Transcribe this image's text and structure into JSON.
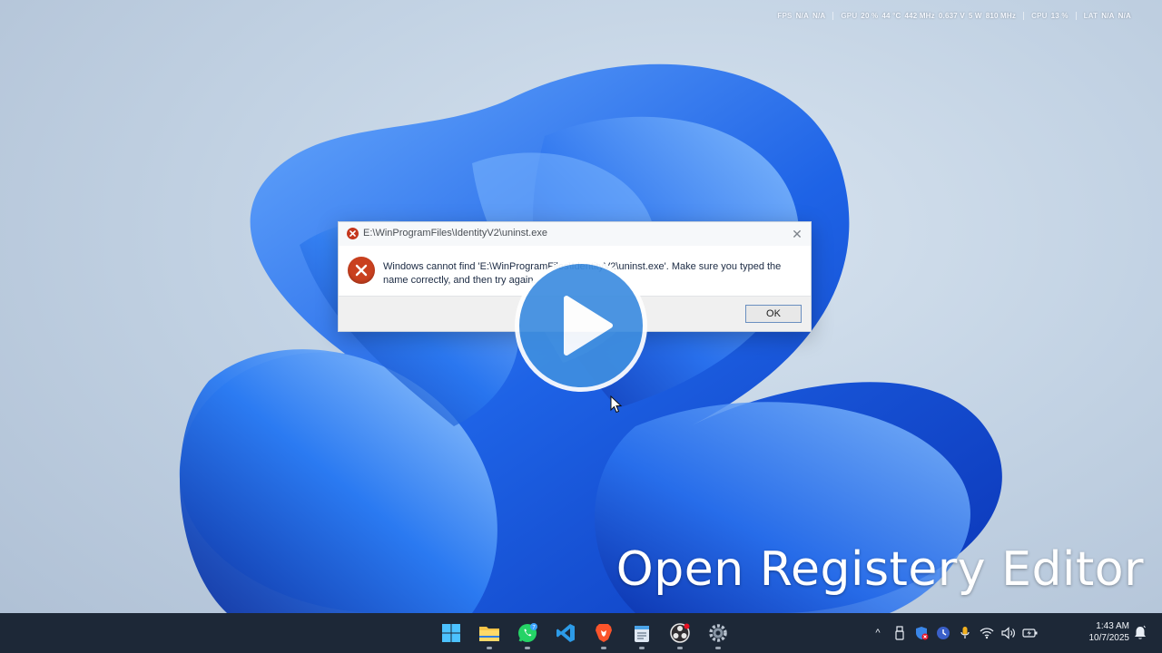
{
  "overlay": {
    "fps_label": "FPS",
    "fps_value_1": "N/A",
    "fps_value_2": "N/A",
    "gpu_label": "GPU",
    "gpu_usage": "20 %",
    "gpu_temp": "44 °C",
    "gpu_clock": "442 MHz",
    "gpu_voltage": "0.637 V",
    "gpu_power": "5 W",
    "gpu_mem": "810 MHz",
    "cpu_label": "CPU",
    "cpu_usage": "13 %",
    "lat_label": "LAT",
    "lat_value_1": "N/A",
    "lat_value_2": "N/A"
  },
  "dialog": {
    "title": "E:\\WinProgramFiles\\IdentityV2\\uninst.exe",
    "message": "Windows cannot find 'E:\\WinProgramFiles\\IdentityV2\\uninst.exe'. Make sure you typed the name correctly, and then try again.",
    "ok_label": "OK",
    "close_glyph": "✕"
  },
  "caption": "Open Registery Editor",
  "taskbar": {
    "apps": [
      "windows-start-icon",
      "file-explorer-icon",
      "whatsapp-icon",
      "vscode-icon",
      "brave-icon",
      "notepad-icon",
      "obs-icon",
      "settings-icon"
    ],
    "whatsapp_badge": "7"
  },
  "tray": {
    "chevron_glyph": "^",
    "time": "1:43 AM",
    "date": "10/7/2025"
  },
  "colors": {
    "accent_blue": "#2f6fe0",
    "error_red": "#c9401f",
    "taskbar": "#1d2837"
  }
}
